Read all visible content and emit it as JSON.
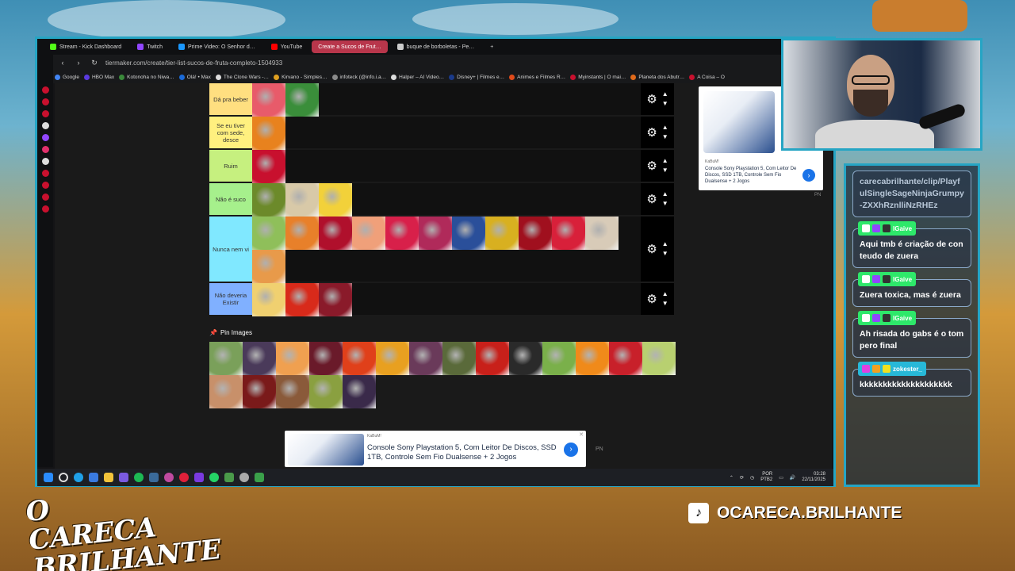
{
  "browser": {
    "tabs": [
      {
        "label": "Stream - Kick Dashboard",
        "color": "#53fc18",
        "active": false
      },
      {
        "label": "Twitch",
        "color": "#9146ff",
        "active": false
      },
      {
        "label": "Prime Video: O Senhor d…",
        "color": "#1a98ff",
        "active": false
      },
      {
        "label": "YouTube",
        "color": "#ff0000",
        "active": false
      },
      {
        "label": "Create a Sucos de Frut…",
        "color": "#ffffff",
        "active": true
      },
      {
        "label": "buque de borboletas - Pe…",
        "color": "#cccccc",
        "active": false
      }
    ],
    "url": "tiermaker.com/create/tier-list-sucos-de-fruta-completo-1504933",
    "bookmarks": [
      "Google",
      "HBO Max",
      "Kotonoha no Niwa…",
      "Olá! • Max",
      "The Clone Wars -…",
      "Kirvano - Simples…",
      "infoteck (@info.i.a…",
      "Halper – AI Video…",
      "Disney+ | Filmes e…",
      "Animes e Filmes R…",
      "Myinstants | O mai…",
      "Planeta dos Abutr…",
      "A Coisa – O"
    ]
  },
  "tiers": [
    {
      "label": "Dá pra beber",
      "color": "#ffdf80",
      "items": [
        "#e85b6a",
        "#3a8e3a"
      ]
    },
    {
      "label": "Se eu tiver com sede, desce",
      "color": "#fff07f",
      "items": [
        "#e8821e"
      ]
    },
    {
      "label": "Ruim",
      "color": "#c6f07f",
      "items": [
        "#c8102e"
      ]
    },
    {
      "label": "Não é suco",
      "color": "#a6f08c",
      "items": [
        "#6c8a2a",
        "#d8c9a8",
        "#f2d13a"
      ]
    },
    {
      "label": "Nunca nem vi",
      "color": "#80e8ff",
      "items": [
        "#8fbf5a",
        "#e8802a",
        "#b0102c",
        "#f0a07a",
        "#d8204a",
        "#b02a5a",
        "#2a4f9a",
        "#d8b020",
        "#a0101e",
        "#d8203a",
        "#d8cbb8",
        "#e89a4a"
      ]
    },
    {
      "label": "Não deveria Existir",
      "color": "#80b0ff",
      "items": [
        "#f0d070",
        "#d82a1a",
        "#8a1a2a"
      ]
    }
  ],
  "pin_images": {
    "title": "Pin Images",
    "items": [
      "#7aa05a",
      "#4a3a5a",
      "#f0a050",
      "#6a1a2a",
      "#e0401a",
      "#e8a020",
      "#6a3a5a",
      "#5a6a3a",
      "#c8201a",
      "#2a2a2a",
      "#7ab04a",
      "#f08a1a",
      "#c8202a",
      "#b8d070",
      "#c8906a",
      "#7a1a1a",
      "#8a5a3a",
      "#8aa040",
      "#3a2a4a"
    ]
  },
  "ad_right": {
    "brand": "KaBuM!",
    "text": "Console Sony Playstation 5, Com Leitor De Discos, SSD 1TB, Controle Sem Fio Dualsense + 2 Jogos",
    "tag": "PN"
  },
  "ad_bottom": {
    "brand": "KaBuM!",
    "text": "Console Sony Playstation 5, Com Leitor De Discos, SSD 1TB, Controle Sem Fio Dualsense + 2 Jogos",
    "tag": "PN"
  },
  "taskbar": {
    "lang": "POR",
    "layout": "PTB2",
    "time": "03:28",
    "date": "22/11/2025"
  },
  "chat": {
    "messages": [
      {
        "user": "",
        "text": "carecabrilhante/clip/PlayfulSingleSageNinjaGrumpy-ZXXhRznlliNzRHEz"
      },
      {
        "user": "lGaive",
        "text": "Aqui tmb é criação de conteudo de zuera"
      },
      {
        "user": "lGaive",
        "text": "Zuera toxica, mas é zuera"
      },
      {
        "user": "lGaive",
        "text": "Ah risada do gabs é o tompero final"
      },
      {
        "user": "zokester_",
        "text": "kkkkkkkkkkkkkkkkkkkk"
      }
    ]
  },
  "branding": {
    "logo_line1": "O CARECA",
    "logo_line2": "BRILHANTE",
    "tiktok_handle": "OCARECA.BRILHANTE"
  }
}
